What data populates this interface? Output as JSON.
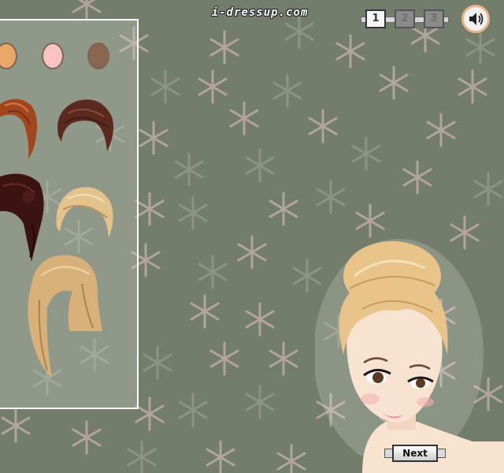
{
  "site": {
    "logo_text": "i-dressup.com"
  },
  "steps": {
    "items": [
      "1",
      "2",
      "3"
    ],
    "active_index": 0
  },
  "sound": {
    "icon": "speaker-icon"
  },
  "skin_tones": {
    "colors": [
      "#e9a86a",
      "#f9c3c2",
      "#8a6650"
    ]
  },
  "hair_options": [
    {
      "name": "auburn-long",
      "color": "#a2461d"
    },
    {
      "name": "brown-short",
      "color": "#5a2a1f"
    },
    {
      "name": "dark-curly-updo",
      "color": "#3b1412"
    },
    {
      "name": "blonde-short",
      "color": "#e3c28c"
    },
    {
      "name": "blonde-long-bangs",
      "color": "#d7b07a"
    }
  ],
  "doll": {
    "hair_color": "#e8c48a",
    "skin_color": "#f8e2d0"
  },
  "next_button": {
    "label": "Next"
  },
  "theme": {
    "background": "#737d6c",
    "flower": "#c9b2b1",
    "accent": "#e8b48c"
  }
}
